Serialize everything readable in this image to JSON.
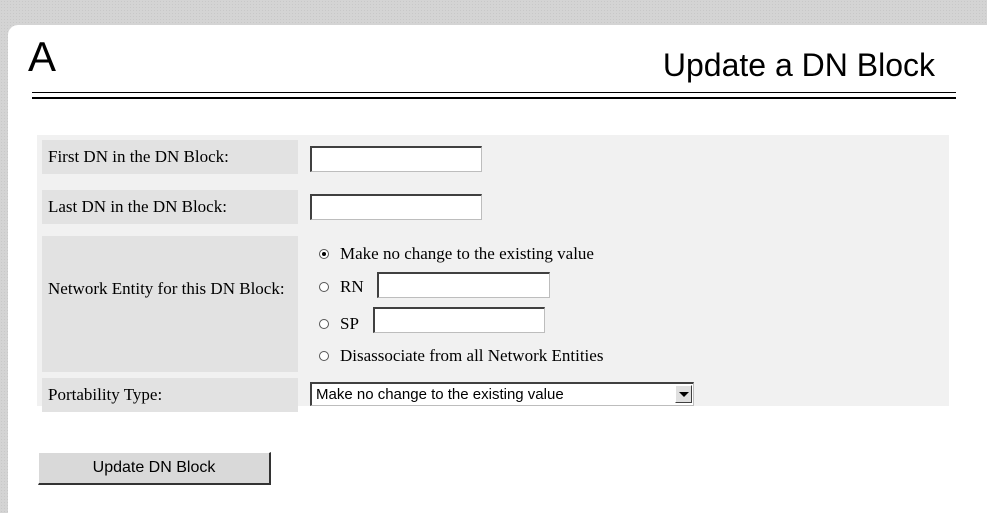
{
  "header": {
    "logo_text": "A",
    "title": "Update a DN Block"
  },
  "form": {
    "first_dn_label": "First DN in the DN Block:",
    "first_dn_value": "",
    "last_dn_label": "Last DN in the DN Block:",
    "last_dn_value": "",
    "network_entity_label": "Network Entity for this DN Block:",
    "network_entity_options": {
      "no_change": "Make no change to the existing value",
      "rn": "RN",
      "sp": "SP",
      "disassociate": "Disassociate from all Network Entities"
    },
    "network_entity_selected": "no_change",
    "rn_value": "",
    "sp_value": "",
    "portability_label": "Portability Type:",
    "portability_selected": "Make no change to the existing value"
  },
  "actions": {
    "update_label": "Update DN Block"
  }
}
